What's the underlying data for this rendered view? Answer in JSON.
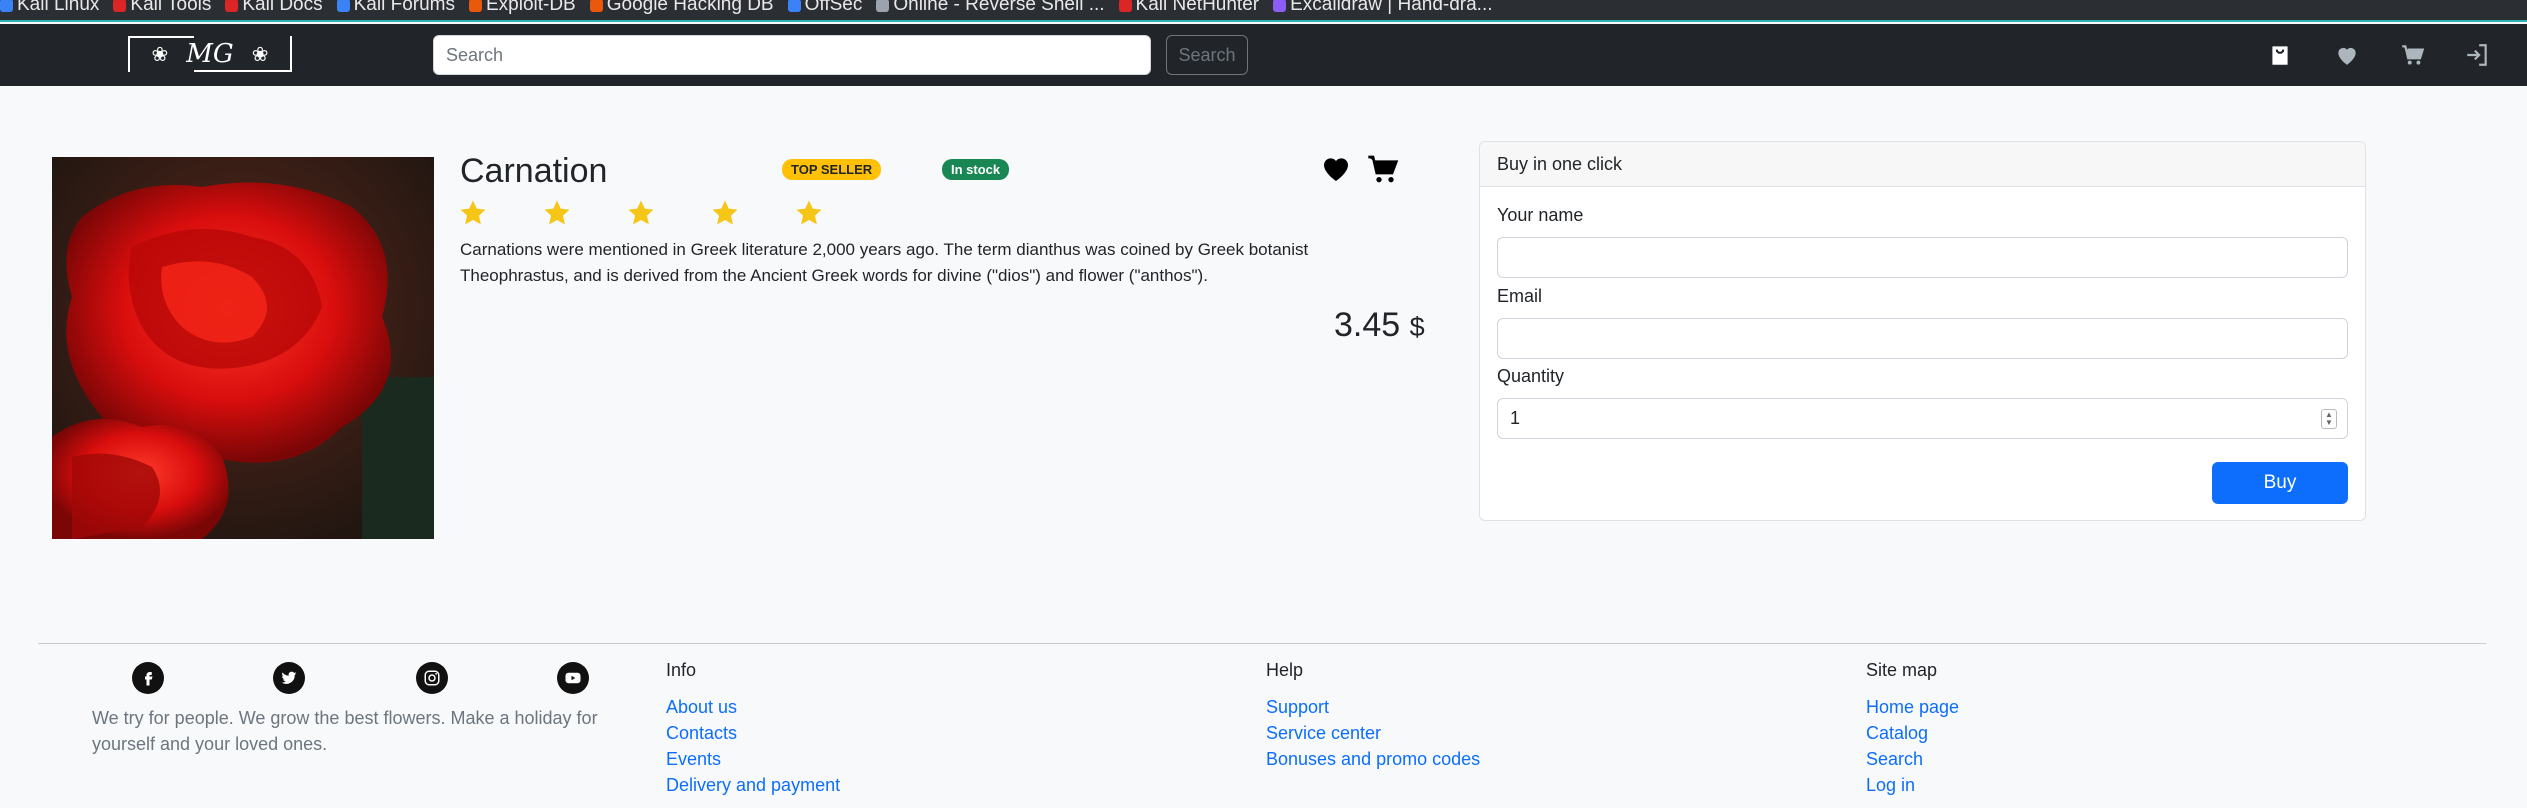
{
  "bookmarks": [
    {
      "label": "Kali Linux",
      "color": "#3b82f6"
    },
    {
      "label": "Kali Tools",
      "color": "#dc2626"
    },
    {
      "label": "Kali Docs",
      "color": "#dc2626"
    },
    {
      "label": "Kali Forums",
      "color": "#3b82f6"
    },
    {
      "label": "Exploit-DB",
      "color": "#ea580c"
    },
    {
      "label": "Google Hacking DB",
      "color": "#ea580c"
    },
    {
      "label": "OffSec",
      "color": "#3b82f6"
    },
    {
      "label": "Online - Reverse Shell ...",
      "color": "#9ca3af"
    },
    {
      "label": "Kali NetHunter",
      "color": "#dc2626"
    },
    {
      "label": "Excalidraw | Hand-dra...",
      "color": "#8b5cf6"
    }
  ],
  "navbar": {
    "logo_text": "MG",
    "search_placeholder": "Search",
    "search_button": "Search"
  },
  "product": {
    "title": "Carnation",
    "badge_top": "TOP SELLER",
    "badge_stock": "In stock",
    "rating": 5,
    "description": "Carnations were mentioned in Greek literature 2,000 years ago. The term dianthus was coined by Greek botanist Theophrastus, and is derived from the Ancient Greek words for divine (\"dios\") and flower (\"anthos\").",
    "price": "3.45",
    "currency": "$"
  },
  "buy": {
    "header": "Buy in one click",
    "name_label": "Your name",
    "email_label": "Email",
    "quantity_label": "Quantity",
    "quantity_value": "1",
    "button": "Buy"
  },
  "footer": {
    "tagline": "We try for people. We grow the best flowers. Make a holiday for yourself and your loved ones.",
    "info": {
      "title": "Info",
      "links": [
        "About us",
        "Contacts",
        "Events",
        "Delivery and payment"
      ]
    },
    "help": {
      "title": "Help",
      "links": [
        "Support",
        "Service center",
        "Bonuses and promo codes"
      ]
    },
    "sitemap": {
      "title": "Site map",
      "links": [
        "Home page",
        "Catalog",
        "Search",
        "Log in"
      ]
    }
  },
  "colors": {
    "primary": "#0d6efd",
    "top_seller": "#ffc107",
    "in_stock": "#198754",
    "navbar": "#212529",
    "star": "#f5c518"
  }
}
